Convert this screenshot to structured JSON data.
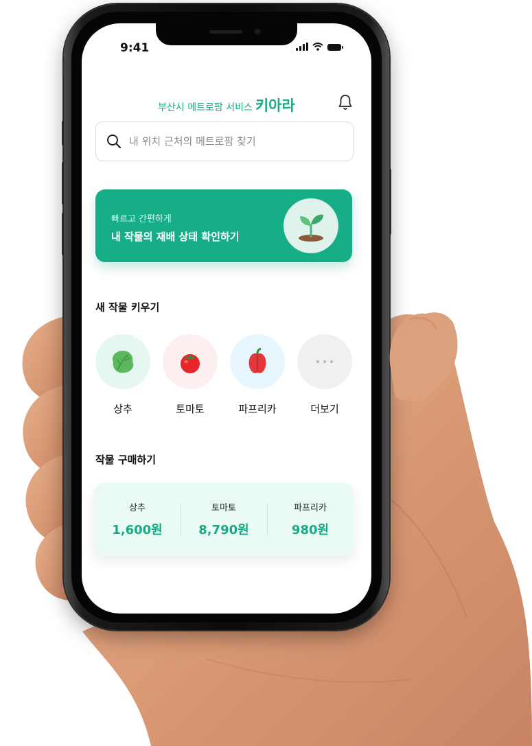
{
  "status_bar": {
    "time": "9:41"
  },
  "header": {
    "subtitle": "부산시 메트로팜 서비스",
    "brand": "키아라",
    "notification_icon": "bell-icon"
  },
  "search": {
    "placeholder": "내 위치 근처의 메트로팜 찾기",
    "icon": "search-icon"
  },
  "banner": {
    "subtitle": "빠르고 간편하게",
    "title": "내 작물의 재배 상태 확인하기",
    "icon": "sprout-icon"
  },
  "grow": {
    "title": "새 작물 키우기",
    "items": [
      {
        "label": "상추",
        "icon": "lettuce-icon",
        "bg": "#e6f7ef"
      },
      {
        "label": "토마토",
        "icon": "tomato-icon",
        "bg": "#fdeef0"
      },
      {
        "label": "파프리카",
        "icon": "paprika-icon",
        "bg": "#e7f6fd"
      },
      {
        "label": "더보기",
        "icon": "more-icon",
        "bg": "#f0f0f0"
      }
    ]
  },
  "purchase": {
    "title": "작물 구매하기",
    "items": [
      {
        "name": "상추",
        "price": "1,600원"
      },
      {
        "name": "토마토",
        "price": "8,790원"
      },
      {
        "name": "파프리카",
        "price": "980원"
      }
    ]
  },
  "colors": {
    "accent": "#17a985",
    "banner": "#17ad86"
  }
}
